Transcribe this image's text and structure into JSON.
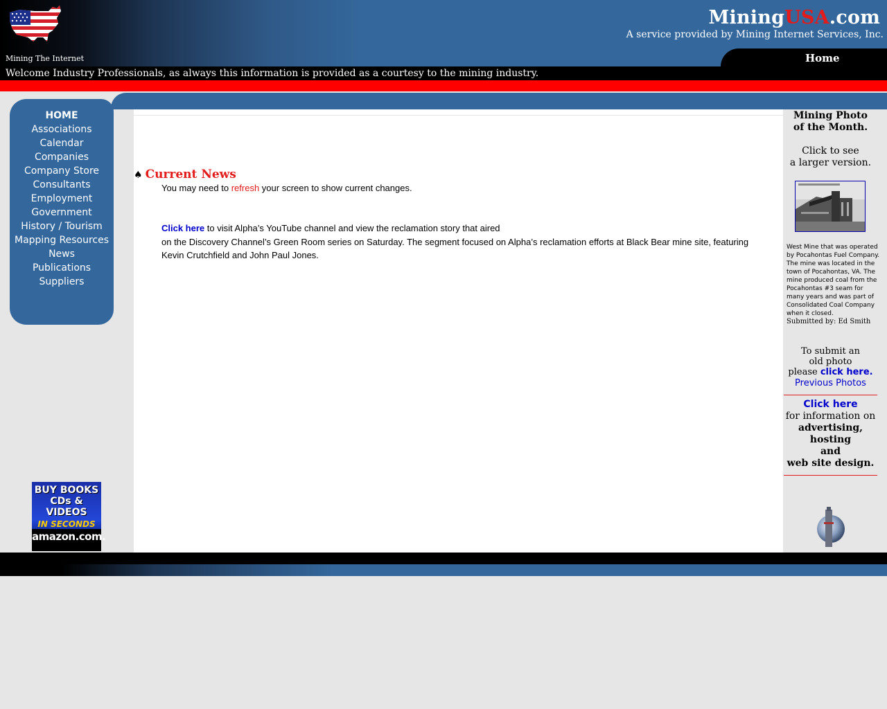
{
  "header": {
    "tagline": "Mining The Internet",
    "title_part1": "Mining",
    "title_part2": "USA",
    "title_part3": ".com",
    "subtitle": "A service provided by Mining Internet Services, Inc.",
    "home_tab": "Home",
    "welcome": "Welcome Industry Professionals, as always this information is provided as a courtesy to the mining industry."
  },
  "nav": {
    "items": [
      {
        "label": "HOME"
      },
      {
        "label": "Associations"
      },
      {
        "label": "Calendar"
      },
      {
        "label": "Companies"
      },
      {
        "label": "Company Store"
      },
      {
        "label": "Consultants"
      },
      {
        "label": "Employment"
      },
      {
        "label": "Government"
      },
      {
        "label": "History / Tourism"
      },
      {
        "label": "Mapping Resources"
      },
      {
        "label": "News"
      },
      {
        "label": "Publications"
      },
      {
        "label": "Suppliers"
      }
    ]
  },
  "amazon_ad": {
    "line1a": "BUY BOOKS",
    "line1b": "CDs &",
    "line1c": "VIDEOS",
    "line2": "IN SECONDS",
    "line3": "amazon.com."
  },
  "main": {
    "heading": "Current News",
    "refresh_pre": "You may need to ",
    "refresh_link": "refresh",
    "refresh_post": " your screen to show current changes.",
    "link_text": "Click here",
    "para_line1": " to visit Alpha’s YouTube channel and view the reclamation story that aired",
    "para_rest": "on the Discovery Channel’s Green Room series on Saturday. The segment focused on Alpha’s reclamation efforts at Black Bear mine site, featuring Kevin Crutchfield and John Paul Jones."
  },
  "right": {
    "photo_title_1": "Mining Photo",
    "photo_title_2": "of the Month.",
    "click_see_1": "Click to see",
    "click_see_2": "a larger version.",
    "caption": "West Mine that was operated by Pocahontas Fuel Company. The mine was located in the town of Pocahontas, VA. The mine produced coal from the Pocahontas #3 seam for many years and was part of Consolidated Coal Company when it closed.",
    "submitted_by": "Submitted by: Ed Smith",
    "submit_1": "To submit an",
    "submit_2": "old photo",
    "submit_3": "please ",
    "submit_link": "click here.",
    "previous_photos": "Previous Photos",
    "ad_link": "Click here",
    "ad_1": "for information on",
    "ad_2": "advertising,",
    "ad_3": "hosting",
    "ad_4": "and",
    "ad_5": "web site design."
  }
}
